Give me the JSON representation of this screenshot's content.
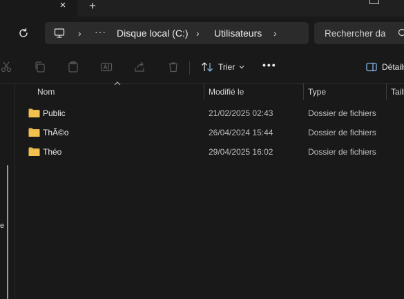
{
  "tabs": {
    "close_symbol": "×",
    "new_tab_symbol": "+"
  },
  "address_bar": {
    "overflow": "···",
    "crumbs": [
      "Disque local (C:)",
      "Utilisateurs"
    ],
    "chevron": "›"
  },
  "search": {
    "placeholder": "Rechercher da"
  },
  "command_bar": {
    "sort_label": "Trier",
    "more": "•••",
    "details_label": "Détails"
  },
  "nav_pane": {
    "label_fragment": "e"
  },
  "columns": {
    "name": "Nom",
    "modified": "Modifié le",
    "type": "Type",
    "size": "Taille"
  },
  "files": [
    {
      "name": "Public",
      "modified": "21/02/2025 02:43",
      "type": "Dossier de fichiers"
    },
    {
      "name": "ThÃ©o",
      "modified": "26/04/2024 15:44",
      "type": "Dossier de fichiers"
    },
    {
      "name": "Théo",
      "modified": "29/04/2025 16:02",
      "type": "Dossier de fichiers"
    }
  ],
  "colors": {
    "folder": "#f2c14e",
    "background": "#191919",
    "address_bg": "#2b2b2b"
  },
  "icons": [
    "close-icon",
    "plus-icon",
    "refresh-icon",
    "computer-icon",
    "search-icon",
    "cut-icon",
    "copy-icon",
    "paste-icon",
    "rename-icon",
    "share-icon",
    "delete-icon",
    "sort-icon",
    "details-pane-icon",
    "folder-icon"
  ]
}
